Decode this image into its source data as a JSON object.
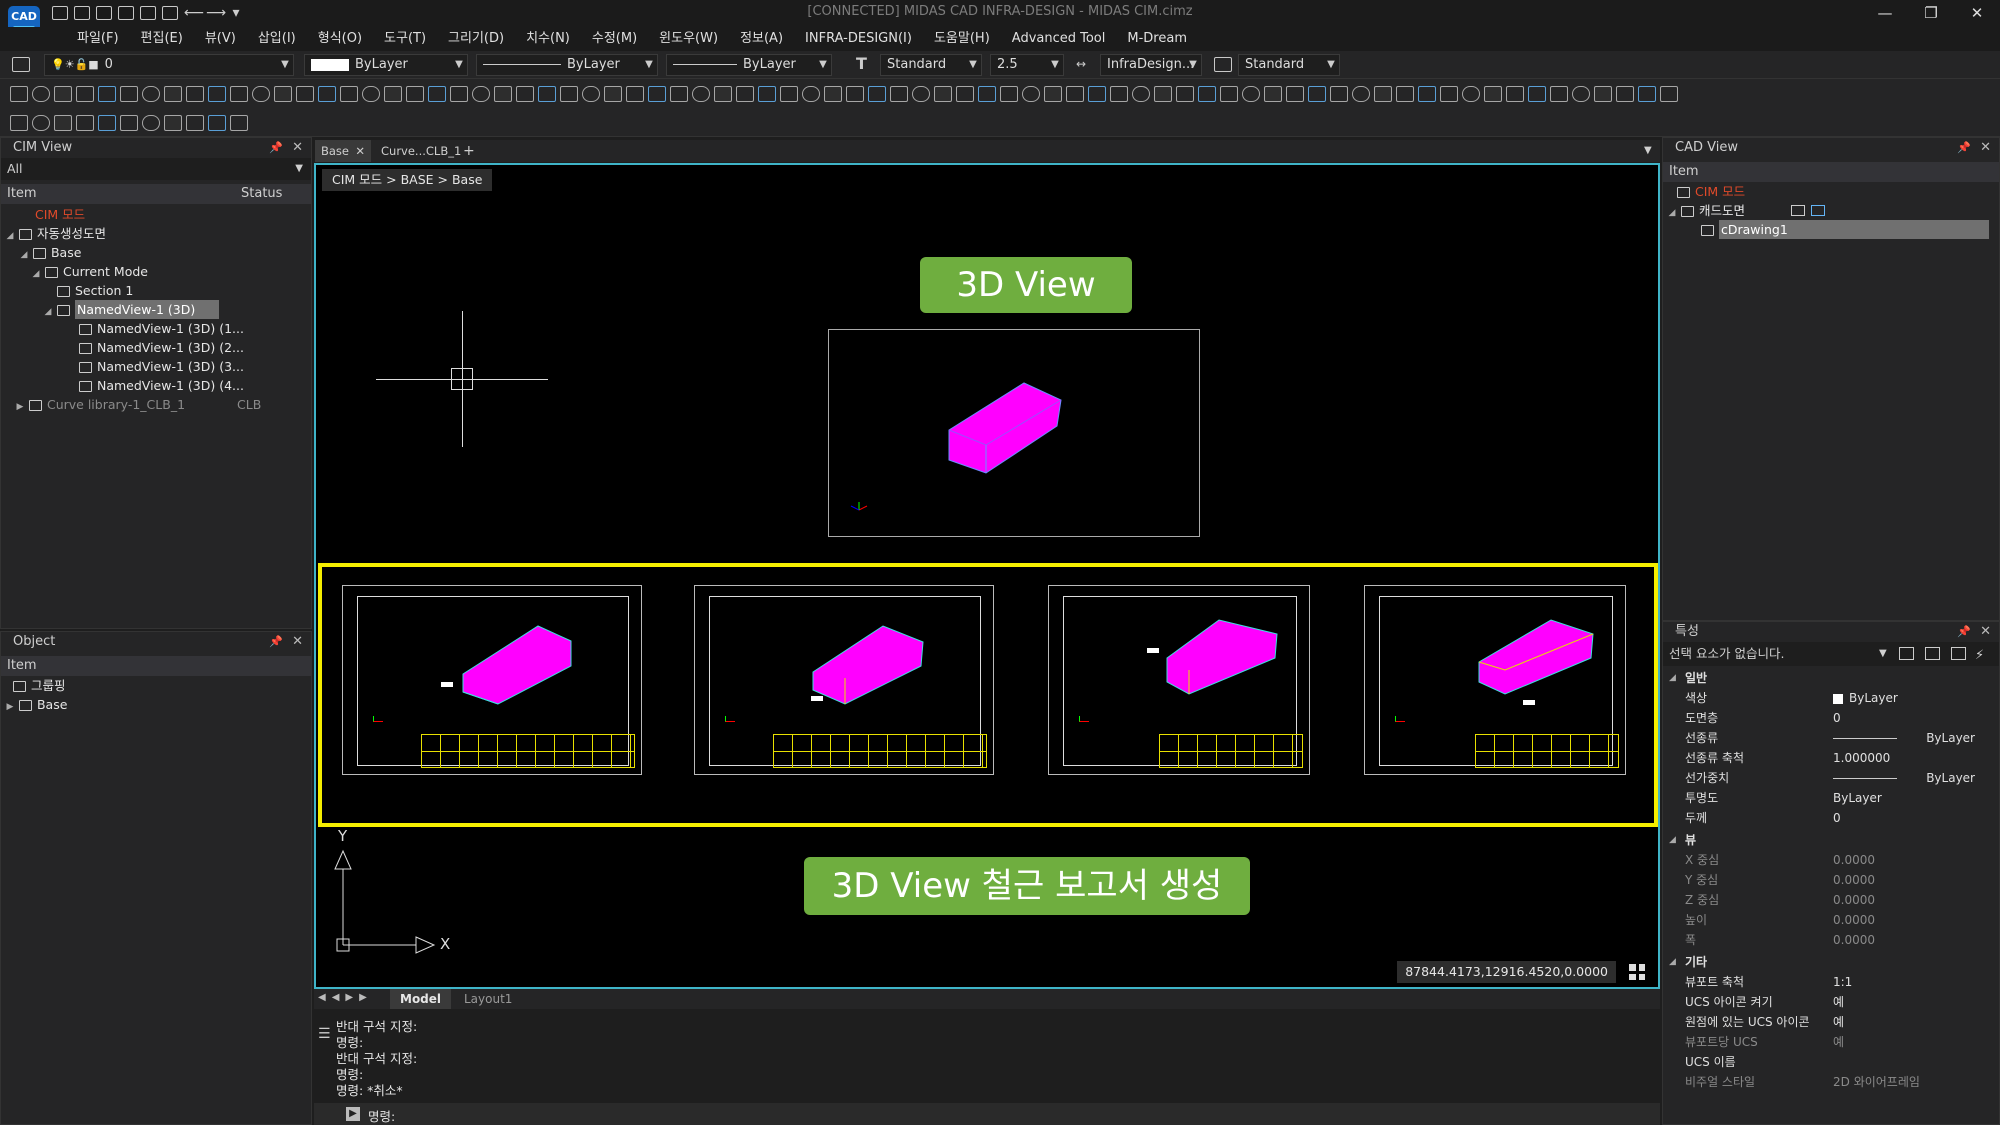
{
  "window": {
    "title": "[CONNECTED] MIDAS CAD INFRA-DESIGN - MIDAS CIM.cimz",
    "logo": "CAD",
    "controls": [
      "—",
      "❐",
      "✕"
    ]
  },
  "menu": [
    "파일(F)",
    "편집(E)",
    "뷰(V)",
    "삽입(I)",
    "형식(O)",
    "도구(T)",
    "그리기(D)",
    "치수(N)",
    "수정(M)",
    "윈도우(W)",
    "정보(A)",
    "INFRA-DESIGN(I)",
    "도움말(H)",
    "Advanced Tool",
    "M-Dream"
  ],
  "toolbar": {
    "layer_value": "0",
    "color_value": "ByLayer",
    "linetype_value": "ByLayer",
    "lineweight_value": "ByLayer",
    "textstyle_value": "Standard",
    "textheight_value": "2.5",
    "dimstyle_value": "InfraDesign...",
    "tablestyle_value": "Standard"
  },
  "cim_view": {
    "title": "CIM View",
    "filter": "All",
    "col_item": "Item",
    "col_status": "Status",
    "root": "CIM 모드",
    "rows": [
      {
        "label": "자동생성도면",
        "status": ""
      },
      {
        "label": "Base",
        "status": ""
      },
      {
        "label": "Current Mode",
        "status": ""
      },
      {
        "label": "Section 1",
        "status": ""
      },
      {
        "label": "NamedView-1 (3D)",
        "status": ""
      },
      {
        "label": "NamedView-1 (3D) (1...",
        "status": ""
      },
      {
        "label": "NamedView-1 (3D) (2...",
        "status": ""
      },
      {
        "label": "NamedView-1 (3D) (3...",
        "status": ""
      },
      {
        "label": "NamedView-1 (3D) (4...",
        "status": ""
      },
      {
        "label": "Curve library-1_CLB_1",
        "status": "CLB"
      }
    ]
  },
  "object_panel": {
    "title": "Object",
    "col_item": "Item",
    "rows": [
      "그룹핑",
      "Base"
    ]
  },
  "doc_tabs": [
    {
      "label": "Base",
      "close": "✕"
    },
    {
      "label": "Curve...CLB_1",
      "close": ""
    }
  ],
  "doc_tab_add": "+",
  "viewport": {
    "breadcrumb": "CIM 모드 > BASE > Base",
    "label_top": "3D View",
    "label_bottom": "3D View 철근 보고서 생성",
    "axis_y": "Y",
    "axis_x": "X",
    "coords": "87844.4173,12916.4520,0.0000"
  },
  "layout_tabs": [
    "Model",
    "Layout1"
  ],
  "command": {
    "lines": [
      "반대 구석 지정:",
      "명령:",
      "반대 구석 지정:",
      "명령:",
      "명령: *취소*"
    ],
    "prompt": "명령:"
  },
  "cad_view": {
    "title": "CAD View",
    "col_item": "Item",
    "root": "CIM 모드",
    "child": "캐드도면",
    "leaf": "cDrawing1"
  },
  "properties": {
    "title": "특성",
    "selection": "선택 요소가 없습니다.",
    "sections": [
      {
        "name": "일반",
        "rows": [
          {
            "k": "색상",
            "v": "ByLayer"
          },
          {
            "k": "도면층",
            "v": "0"
          },
          {
            "k": "선종류",
            "v": "ByLayer"
          },
          {
            "k": "선종류 축척",
            "v": "1.000000"
          },
          {
            "k": "선가중치",
            "v": "ByLayer"
          },
          {
            "k": "투명도",
            "v": "ByLayer"
          },
          {
            "k": "두께",
            "v": "0"
          }
        ]
      },
      {
        "name": "뷰",
        "rows": [
          {
            "k": "X 중심",
            "v": "0.0000"
          },
          {
            "k": "Y 중심",
            "v": "0.0000"
          },
          {
            "k": "Z 중심",
            "v": "0.0000"
          },
          {
            "k": "높이",
            "v": "0.0000"
          },
          {
            "k": "폭",
            "v": "0.0000"
          }
        ]
      },
      {
        "name": "기타",
        "rows": [
          {
            "k": "뷰포트 축척",
            "v": "1:1"
          },
          {
            "k": "UCS 아이콘 켜기",
            "v": "예"
          },
          {
            "k": "원점에 있는 UCS 아이콘",
            "v": "예"
          },
          {
            "k": "뷰포트당 UCS",
            "v": "예"
          },
          {
            "k": "UCS 이름",
            "v": ""
          },
          {
            "k": "비주얼 스타일",
            "v": "2D 와이어프레임"
          }
        ]
      }
    ]
  },
  "colors": {
    "accent_cyan": "#3fb4c8",
    "highlight_yellow": "#f5ee00",
    "label_green": "#6fae3f",
    "model_magenta": "#ff00ff",
    "cim_red": "#e04a2a"
  }
}
